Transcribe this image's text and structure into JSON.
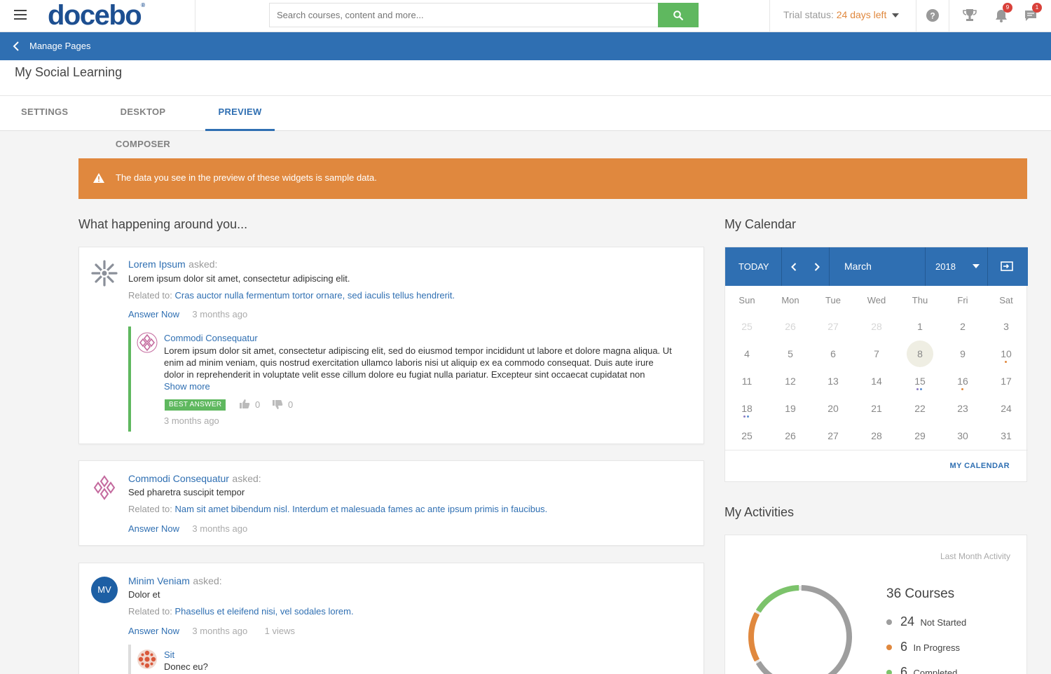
{
  "header": {
    "logo": "docebo",
    "logo_mark": "®",
    "search_placeholder": "Search courses, content and more...",
    "trial_label": "Trial status:",
    "trial_days": "24 days left",
    "notifications_count": "9",
    "messages_count": "1"
  },
  "nav": {
    "back_label": "Manage Pages",
    "page_title": "My Social Learning",
    "tabs": [
      "SETTINGS",
      "DESKTOP COMPOSER",
      "PREVIEW"
    ],
    "active_tab": "PREVIEW"
  },
  "alert": {
    "text": "The data you see in the preview of these widgets is sample data."
  },
  "feed": {
    "title": "What happening around you...",
    "items": [
      {
        "author": "Lorem Ipsum",
        "asked": "asked:",
        "question": "Lorem ipsum dolor sit amet, consectetur adipiscing elit.",
        "related_label": "Related to:",
        "related": "Cras auctor nulla fermentum tortor ornare, sed iaculis tellus hendrerit.",
        "answer_now": "Answer Now",
        "time": "3 months ago",
        "reply": {
          "author": "Commodi Consequatur",
          "lines": [
            "Lorem ipsum dolor sit amet, consectetur adipiscing elit, sed do eiusmod tempor incididunt ut labore et dolore magna aliqua. Ut",
            "enim ad minim veniam, quis nostrud exercitation ullamco laboris nisi ut aliquip ex ea commodo consequat. Duis aute irure",
            "dolor in reprehenderit in voluptate velit esse cillum dolore eu fugiat nulla pariatur. Excepteur sint occaecat cupidatat non"
          ],
          "show_more": "Show more",
          "best_answer": "BEST ANSWER",
          "likes": "0",
          "dislikes": "0",
          "time": "3 months ago"
        }
      },
      {
        "author": "Commodi Consequatur",
        "asked": "asked:",
        "question": "Sed pharetra suscipit tempor",
        "related_label": "Related to:",
        "related": "Nam sit amet bibendum nisl. Interdum et malesuada fames ac ante ipsum primis in faucibus.",
        "answer_now": "Answer Now",
        "time": "3 months ago"
      },
      {
        "author": "Minim Veniam",
        "initials": "MV",
        "asked": "asked:",
        "question": "Dolor et",
        "related_label": "Related to:",
        "related": "Phasellus et eleifend nisi, vel sodales lorem.",
        "answer_now": "Answer Now",
        "time": "3 months ago",
        "views": "1 views",
        "reply": {
          "author": "Sit",
          "text": "Donec eu?"
        }
      }
    ]
  },
  "calendar": {
    "title": "My Calendar",
    "today": "TODAY",
    "month": "March",
    "year": "2018",
    "days_of_week": [
      "Sun",
      "Mon",
      "Tue",
      "Wed",
      "Thu",
      "Fri",
      "Sat"
    ],
    "weeks": [
      [
        "25",
        "26",
        "27",
        "28",
        "1",
        "2",
        "3"
      ],
      [
        "4",
        "5",
        "6",
        "7",
        "8",
        "9",
        "10"
      ],
      [
        "11",
        "12",
        "13",
        "14",
        "15",
        "16",
        "17"
      ],
      [
        "18",
        "19",
        "20",
        "21",
        "22",
        "23",
        "24"
      ],
      [
        "25",
        "26",
        "27",
        "28",
        "29",
        "30",
        "31"
      ]
    ],
    "selected_day": "8",
    "link": "MY CALENDAR",
    "colors": {
      "orange": "#e0883e",
      "purple": "#8e7cc3",
      "blue": "#5b8fd0"
    }
  },
  "activities": {
    "title": "My Activities",
    "subtitle": "Last Month Activity",
    "total": "36 Courses",
    "legend": [
      {
        "value": "24",
        "label": "Not Started",
        "color": "#9e9e9e"
      },
      {
        "value": "6",
        "label": "In Progress",
        "color": "#e0883e"
      },
      {
        "value": "6",
        "label": "Completed",
        "color": "#7cc36b"
      }
    ]
  }
}
